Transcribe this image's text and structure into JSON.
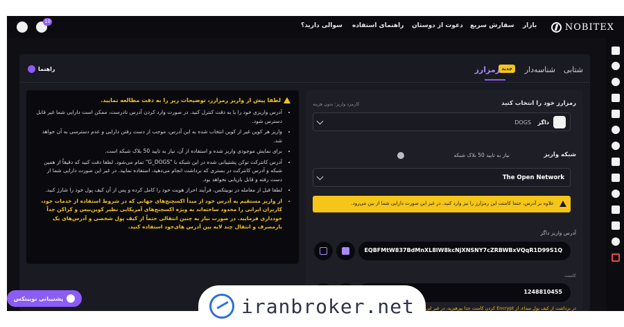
{
  "topbar": {
    "brand": "NOBITEX",
    "nav": [
      "بازار",
      "سفارش سریع",
      "دعوت از دوستان",
      "راهنمای استفاده",
      "سوالی دارید؟"
    ],
    "notification_count": "10"
  },
  "tabs": {
    "tab_1": "شتابی",
    "tab_2": "شناسه‌دار",
    "new_badge": "جدید",
    "tab_3": "رمزارز",
    "guide": "راهنما"
  },
  "info": {
    "title": "لطفا پیش از واریز رمزارز، توضیحات زیر را به دقت مطالعه نمایید.",
    "items": [
      "آدرس واریزی خود را با به دقت کنترل کنید. در صورت وارد کردن آدرس نادرست، ممکن است دارایی شما غیر قابل دسترس شود.",
      "واریز هر کوین غیر از کوین انتخاب شده به این آدرس، موجب از دست رفتن دارایی و عدم دسترسی به آن خواهد شد.",
      "برای نمایش موجودی واریز شده و استفاده از آن، نیاز به تایید 50 بلاک شبکه است.",
      "آدرس کانترکت توکن پشتیبانی شده در این شبکه با \"G_DOGS\" تمام می‌شود. لطفا دقت کنید که دقیقاً از همین شبکه و آدرس کانترکت در بستری که برداشت انجام می‌دهید، استفاده نمایید. در غیر این صورت دارایی شما از دست رفته و قابل بازیابی نخواهد بود.",
      "لطفا قبل از معامله در نوبیتکس، فرآیند احراز هویت خود را کامل کرده و پس از آن کیف پول خود را شارژ کنید.",
      "از واریز مستقیم به آدرس خود از مبدأ اکسچنج‌های جهانی که در شروط استفاده از خدمات خود، کاربران ایرانی را محدود ساخته‌اند به ویژه اکسچنج‌های آمریکایی نظیر کوین‌بیس و کراکن جداً خودداری فرمایید. در صورت نیاز به چنین انتقالی حتماً از کیف پول شخصی و آدرس‌های یک بارمصرف و انتقال چند لایه بین آدرس های‌خود استفاده کنید."
    ]
  },
  "form": {
    "coin_label": "رمزارز خود را انتخاب کنید",
    "fee_hint": "کارمزد واریز: بدون هزینه",
    "coin_name": "داگز",
    "coin_symbol": "DOGS",
    "network_label": "شبکه واریز",
    "network_hint": "نیاز به تایید 50 بلاک شبکه",
    "network_value": "The Open Network",
    "alert": "علاوه بر آدرس، حتما کامنت این رمزارز را نیز وارد کنید. در غیر این صورت دارایی شما از بین می‌رود.",
    "address_label": "آدرس واریز داگز",
    "address_value": "EQBFMtW837BdMnXL8lW8kcNjXNSNY7cZRBWBxVQqR1D99S1Q",
    "comment_label": "کامنت",
    "comment_value": "1248810455",
    "bottom_note": "در برداشت از کیف پول مبداء، از Encrypt کردن کامنت جدا بپرهیزید، در غیر این"
  },
  "support": {
    "label": "پشتیبانی نوبیتکس"
  },
  "watermark": {
    "text": "iranbroker.net"
  },
  "colors": {
    "accent": "#8b5cf6",
    "warning": "#f5c518",
    "background": "#0f0f14",
    "danger": "#e5484d"
  },
  "icons": [
    "user-icon",
    "bell-icon",
    "grid-icon",
    "chart-icon",
    "refresh-icon",
    "wallet-icon",
    "clipboard-icon",
    "coins-icon",
    "target-icon",
    "id-card-icon",
    "calendar-icon",
    "shield-icon",
    "checklist-icon",
    "mail-icon",
    "add-user-icon",
    "logout-icon",
    "nobitex-logo-icon",
    "info-icon",
    "warning-icon",
    "copy-icon",
    "qr-icon",
    "support-icon"
  ]
}
